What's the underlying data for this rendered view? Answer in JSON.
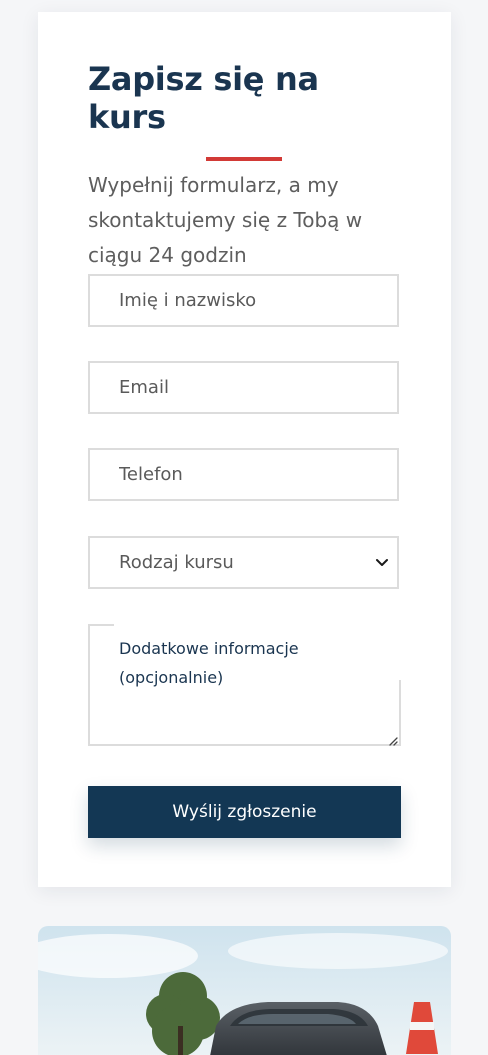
{
  "form": {
    "title": "Zapisz się na kurs",
    "subtitle": "Wypełnij formularz, a my skontaktujemy się z Tobą w ciągu 24 godzin",
    "name_placeholder": "Imię i nazwisko",
    "email_placeholder": "Email",
    "phone_placeholder": "Telefon",
    "course_select_value": "Rodzaj kursu",
    "notes_placeholder": "Dodatkowe informacje (opcjonalnie)",
    "submit_label": "Wyślij zgłoszenie"
  },
  "colors": {
    "title": "#1a3550",
    "accent_underline": "#d23a36",
    "button": "#133754",
    "background": "#f5f6f8"
  },
  "icons": {
    "select_arrow": "chevron-down-icon",
    "textarea_resize": "resize-handle-icon"
  },
  "image": {
    "description_icon": "car-photo"
  }
}
